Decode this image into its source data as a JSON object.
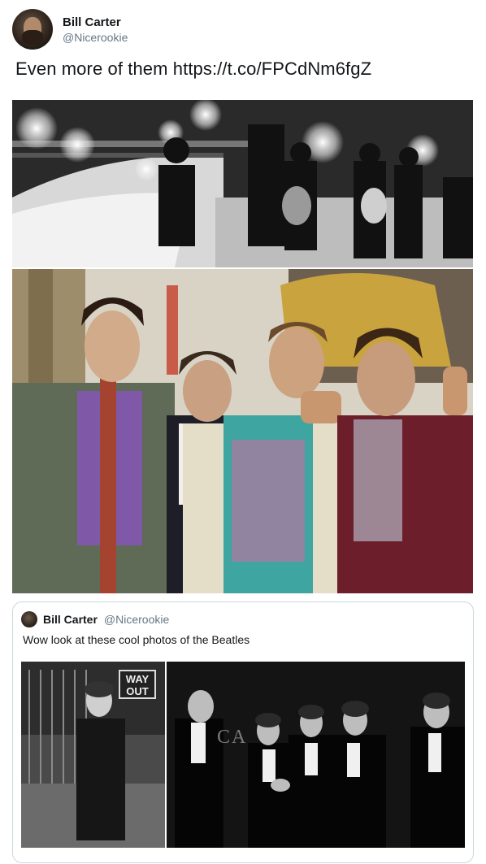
{
  "tweet": {
    "display_name": "Bill Carter",
    "handle": "@Nicerookie",
    "text": "Even more of them https://t.co/FPCdNm6fgZ",
    "avatar_icon": "user-avatar-photo"
  },
  "quoted_tweet": {
    "display_name": "Bill Carter",
    "handle": "@Nicerookie",
    "text": "Wow look at these cool photos of the Beatles",
    "sign_text": "WAY OUT",
    "backdrop_letters": "CA"
  },
  "colors": {
    "text": "#14171a",
    "secondary": "#657786",
    "border": "#ccd6dd"
  }
}
